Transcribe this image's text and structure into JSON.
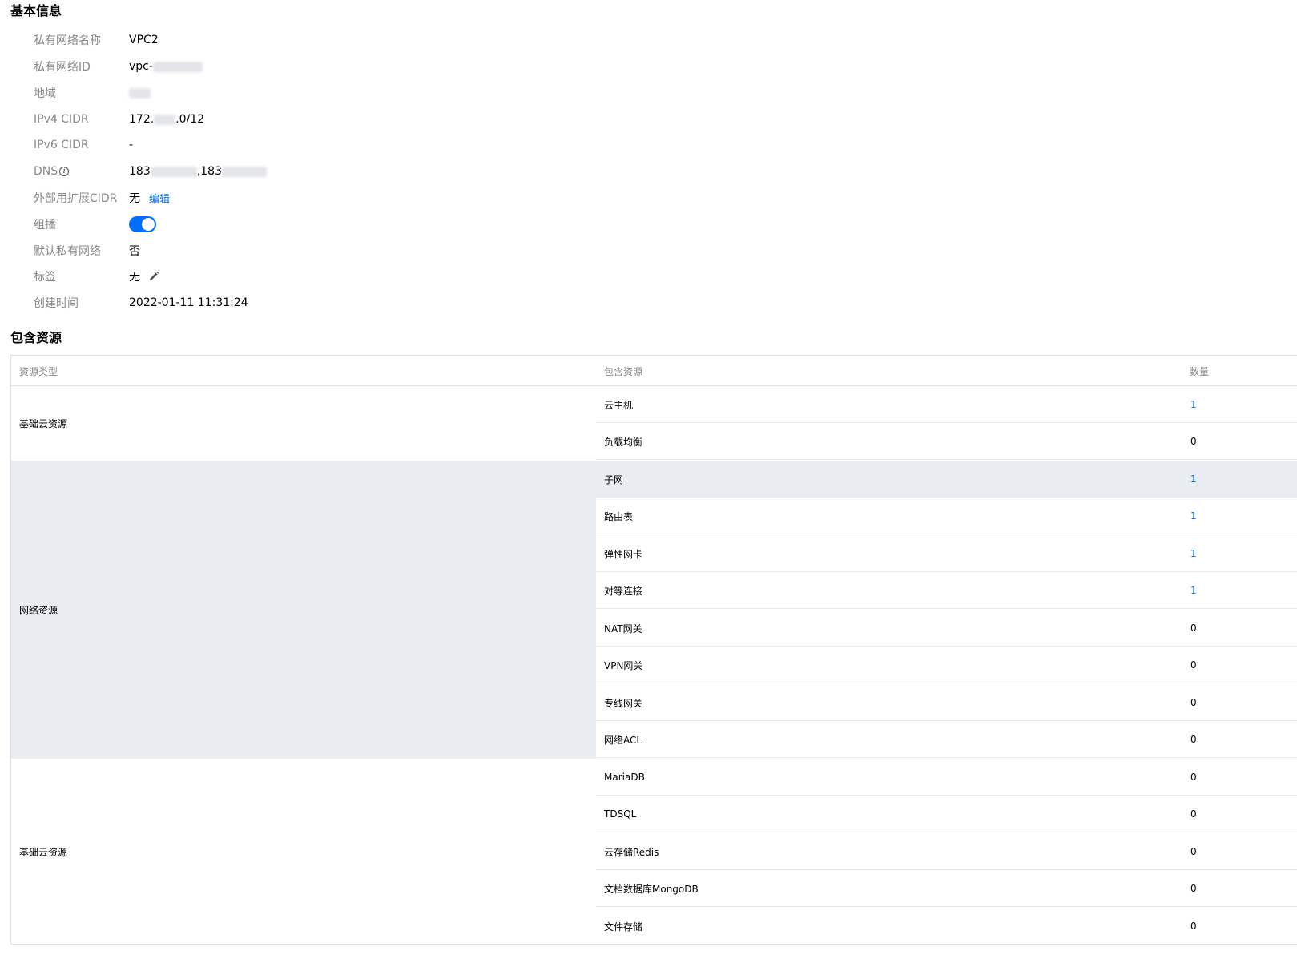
{
  "basic_info": {
    "title": "基本信息",
    "rows": [
      {
        "label": "私有网络名称",
        "value": "VPC2"
      },
      {
        "label": "私有网络ID",
        "prefix": "vpc-"
      },
      {
        "label": "地域"
      },
      {
        "label": "IPv4 CIDR",
        "prefix": "172.",
        "suffix": ".0/12"
      },
      {
        "label": "IPv6 CIDR",
        "value": "-"
      },
      {
        "label": "DNS",
        "prefix": "183",
        "mid": ",183"
      },
      {
        "label": "外部用扩展CIDR",
        "value": "无",
        "action": "编辑"
      },
      {
        "label": "组播",
        "toggle_on": true
      },
      {
        "label": "默认私有网络",
        "value": "否"
      },
      {
        "label": "标签",
        "value": "无"
      },
      {
        "label": "创建时间",
        "value": "2022-01-11 11:31:24"
      }
    ],
    "dns_info_icon": "info-icon",
    "tag_edit_icon": "pencil-icon"
  },
  "resources": {
    "title": "包含资源",
    "columns": [
      "资源类型",
      "包含资源",
      "数量"
    ],
    "groups": [
      {
        "type": "基础云资源",
        "items": [
          {
            "name": "云主机",
            "count": "1",
            "link": true
          },
          {
            "name": "负载均衡",
            "count": "0",
            "link": false
          }
        ]
      },
      {
        "type": "网络资源",
        "items": [
          {
            "name": "子网",
            "count": "1",
            "link": true
          },
          {
            "name": "路由表",
            "count": "1",
            "link": true
          },
          {
            "name": "弹性网卡",
            "count": "1",
            "link": true
          },
          {
            "name": "对等连接",
            "count": "1",
            "link": true
          },
          {
            "name": "NAT网关",
            "count": "0",
            "link": false
          },
          {
            "name": "VPN网关",
            "count": "0",
            "link": false
          },
          {
            "name": "专线网关",
            "count": "0",
            "link": false
          },
          {
            "name": "网络ACL",
            "count": "0",
            "link": false
          }
        ]
      },
      {
        "type": "基础云资源",
        "items": [
          {
            "name": "MariaDB",
            "count": "0",
            "link": false
          },
          {
            "name": "TDSQL",
            "count": "0",
            "link": false
          },
          {
            "name": "云存储Redis",
            "count": "0",
            "link": false
          },
          {
            "name": "文档数据库MongoDB",
            "count": "0",
            "link": false
          },
          {
            "name": "文件存储",
            "count": "0",
            "link": false
          }
        ]
      }
    ]
  },
  "colors": {
    "accent": "#006eff",
    "label": "#888888",
    "shaded_row": "#e9edf1",
    "border": "#dcdfe6"
  }
}
